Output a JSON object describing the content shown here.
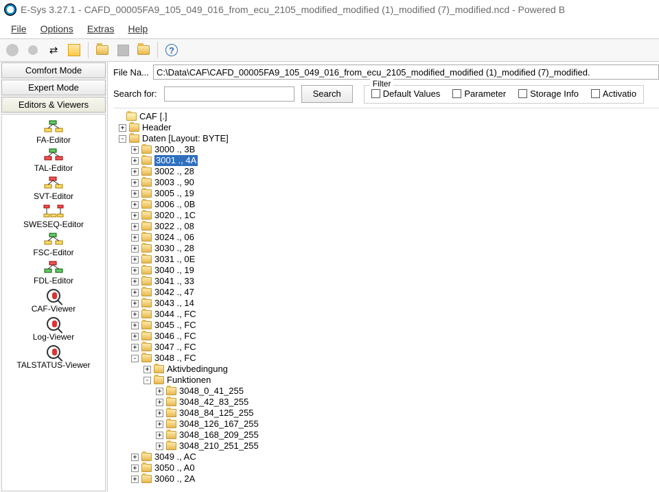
{
  "window": {
    "title": "E-Sys 3.27.1 - CAFD_00005FA9_105_049_016_from_ecu_2105_modified_modified (1)_modified (7)_modified.ncd  - Powered B"
  },
  "menu": {
    "file": "File",
    "options": "Options",
    "extras": "Extras",
    "help": "Help"
  },
  "sidepanel": {
    "comfort": "Comfort Mode",
    "expert": "Expert Mode",
    "editors": "Editors & Viewers",
    "items": [
      {
        "label": "FA-Editor"
      },
      {
        "label": "TAL-Editor"
      },
      {
        "label": "SVT-Editor"
      },
      {
        "label": "SWESEQ-Editor"
      },
      {
        "label": "FSC-Editor"
      },
      {
        "label": "FDL-Editor"
      },
      {
        "label": "CAF-Viewer"
      },
      {
        "label": "Log-Viewer"
      },
      {
        "label": "TALSTATUS-Viewer"
      }
    ]
  },
  "main": {
    "filename_label": "File Na...",
    "filename_value": "C:\\Data\\CAF\\CAFD_00005FA9_105_049_016_from_ecu_2105_modified_modified (1)_modified (7)_modified.",
    "search_label": "Search for:",
    "search_value": "",
    "search_btn": "Search",
    "filter_legend": "Filter",
    "filter": {
      "defaults": "Default Values",
      "param": "Parameter",
      "storage": "Storage Info",
      "activ": "Activatio"
    }
  },
  "tree": {
    "root": "CAF [.]",
    "header": "Header",
    "daten": "Daten [Layout: BYTE]",
    "nodes": [
      {
        "label": "3000 ., 3B"
      },
      {
        "label": "3001 ., 4A",
        "selected": true
      },
      {
        "label": "3002 ., 28"
      },
      {
        "label": "3003 ., 90"
      },
      {
        "label": "3005 ., 19"
      },
      {
        "label": "3006 ., 0B"
      },
      {
        "label": "3020 ., 1C"
      },
      {
        "label": "3022 ., 08"
      },
      {
        "label": "3024 ., 06"
      },
      {
        "label": "3030 ., 28"
      },
      {
        "label": "3031 ., 0E"
      },
      {
        "label": "3040 ., 19"
      },
      {
        "label": "3041 ., 33"
      },
      {
        "label": "3042 ., 47"
      },
      {
        "label": "3043 ., 14"
      },
      {
        "label": "3044 ., FC"
      },
      {
        "label": "3045 ., FC"
      },
      {
        "label": "3046 ., FC"
      },
      {
        "label": "3047 ., FC"
      }
    ],
    "node3048": "3048 ., FC",
    "aktiv": "Aktivbedingung",
    "funk": "Funktionen",
    "funk_children": [
      "3048_0_41_255",
      "3048_42_83_255",
      "3048_84_125_255",
      "3048_126_167_255",
      "3048_168_209_255",
      "3048_210_251_255"
    ],
    "after3048": [
      {
        "label": "3049 ., AC"
      },
      {
        "label": "3050 ., A0"
      },
      {
        "label": "3060 ., 2A"
      }
    ]
  }
}
